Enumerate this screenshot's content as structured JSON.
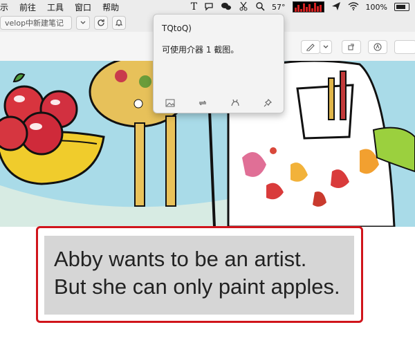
{
  "menubar": {
    "items": [
      "示",
      "前往",
      "工具",
      "窗口",
      "帮助"
    ],
    "status": {
      "temperature": "57°",
      "battery": "100%"
    }
  },
  "toolbar": {
    "tab_text": "velop中新建笔记"
  },
  "popup": {
    "title": "TQtoQ)",
    "message": "可使用介器 1 截图。",
    "icons": [
      "image-icon",
      "loop-icon",
      "pet-icon",
      "pin-icon"
    ]
  },
  "subtitle": {
    "line1": "Abby wants to be an artist.",
    "line2": "But she can only paint apples."
  },
  "colors": {
    "frame": "#d0141b",
    "box": "#d6d6d6"
  }
}
